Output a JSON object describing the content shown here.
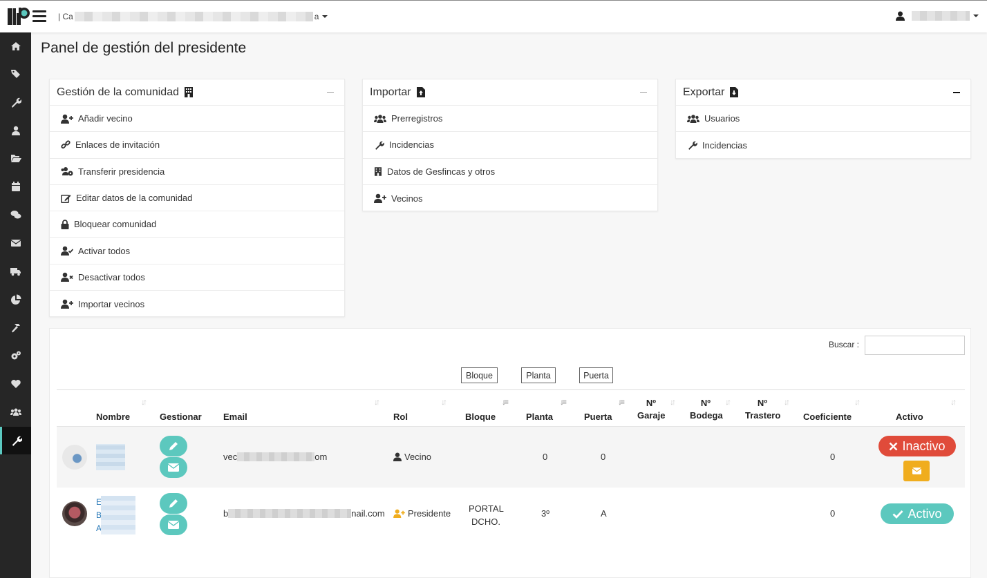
{
  "header": {
    "community_prefix": "| Ca",
    "community_suffix": "a"
  },
  "page": {
    "title": "Panel de gestión del presidente"
  },
  "panels": {
    "gestion": {
      "title": "Gestión de la comunidad",
      "items": [
        {
          "label": "Añadir vecino",
          "icon": "user-plus-icon"
        },
        {
          "label": "Enlaces de invitación",
          "icon": "link-icon"
        },
        {
          "label": "Transferir presidencia",
          "icon": "users-cog-icon"
        },
        {
          "label": "Editar datos de la comunidad",
          "icon": "edit-icon"
        },
        {
          "label": "Bloquear comunidad",
          "icon": "lock-icon"
        },
        {
          "label": "Activar todos",
          "icon": "user-check-icon"
        },
        {
          "label": "Desactivar todos",
          "icon": "user-times-icon"
        },
        {
          "label": "Importar vecinos",
          "icon": "user-plus-icon"
        }
      ]
    },
    "importar": {
      "title": "Importar",
      "items": [
        {
          "label": "Prerregistros",
          "icon": "users-icon"
        },
        {
          "label": "Incidencias",
          "icon": "wrench-icon"
        },
        {
          "label": "Datos de Gesfincas y otros",
          "icon": "building-icon"
        },
        {
          "label": "Vecinos",
          "icon": "user-plus-icon"
        }
      ]
    },
    "exportar": {
      "title": "Exportar",
      "items": [
        {
          "label": "Usuarios",
          "icon": "users-icon"
        },
        {
          "label": "Incidencias",
          "icon": "wrench-icon"
        }
      ]
    }
  },
  "table": {
    "search_label": "Buscar :",
    "filters": [
      "Bloque",
      "Planta",
      "Puerta"
    ],
    "columns": {
      "nombre": "Nombre",
      "gestionar": "Gestionar",
      "email": "Email",
      "rol": "Rol",
      "bloque": "Bloque",
      "planta": "Planta",
      "puerta": "Puerta",
      "garaje_1": "Nº",
      "garaje_2": "Garaje",
      "bodega_1": "Nº",
      "bodega_2": "Bodega",
      "trastero_1": "Nº",
      "trastero_2": "Trastero",
      "coeficiente": "Coeficiente",
      "activo": "Activo"
    },
    "rows": [
      {
        "email_prefix": "vec",
        "email_suffix": "om",
        "rol": "Vecino",
        "bloque_1": "",
        "bloque_2": "",
        "planta": "0",
        "puerta": "0",
        "coeficiente": "0",
        "status": "Inactivo",
        "status_color": "#e04b3a"
      },
      {
        "name_initials": [
          "E",
          "B",
          "A"
        ],
        "email_prefix": "b",
        "email_suffix": "nail.com",
        "rol": "Presidente",
        "bloque_1": "PORTAL",
        "bloque_2": "DCHO.",
        "planta": "3º",
        "puerta": "A",
        "coeficiente": "0",
        "status": "Activo",
        "status_color": "#5cc8be"
      }
    ]
  },
  "colors": {
    "sidebar_bg": "#262626",
    "accent": "#5cc8be",
    "danger": "#e04b3a",
    "warning": "#f0ad1e",
    "president_icon": "#f0ad1e"
  }
}
